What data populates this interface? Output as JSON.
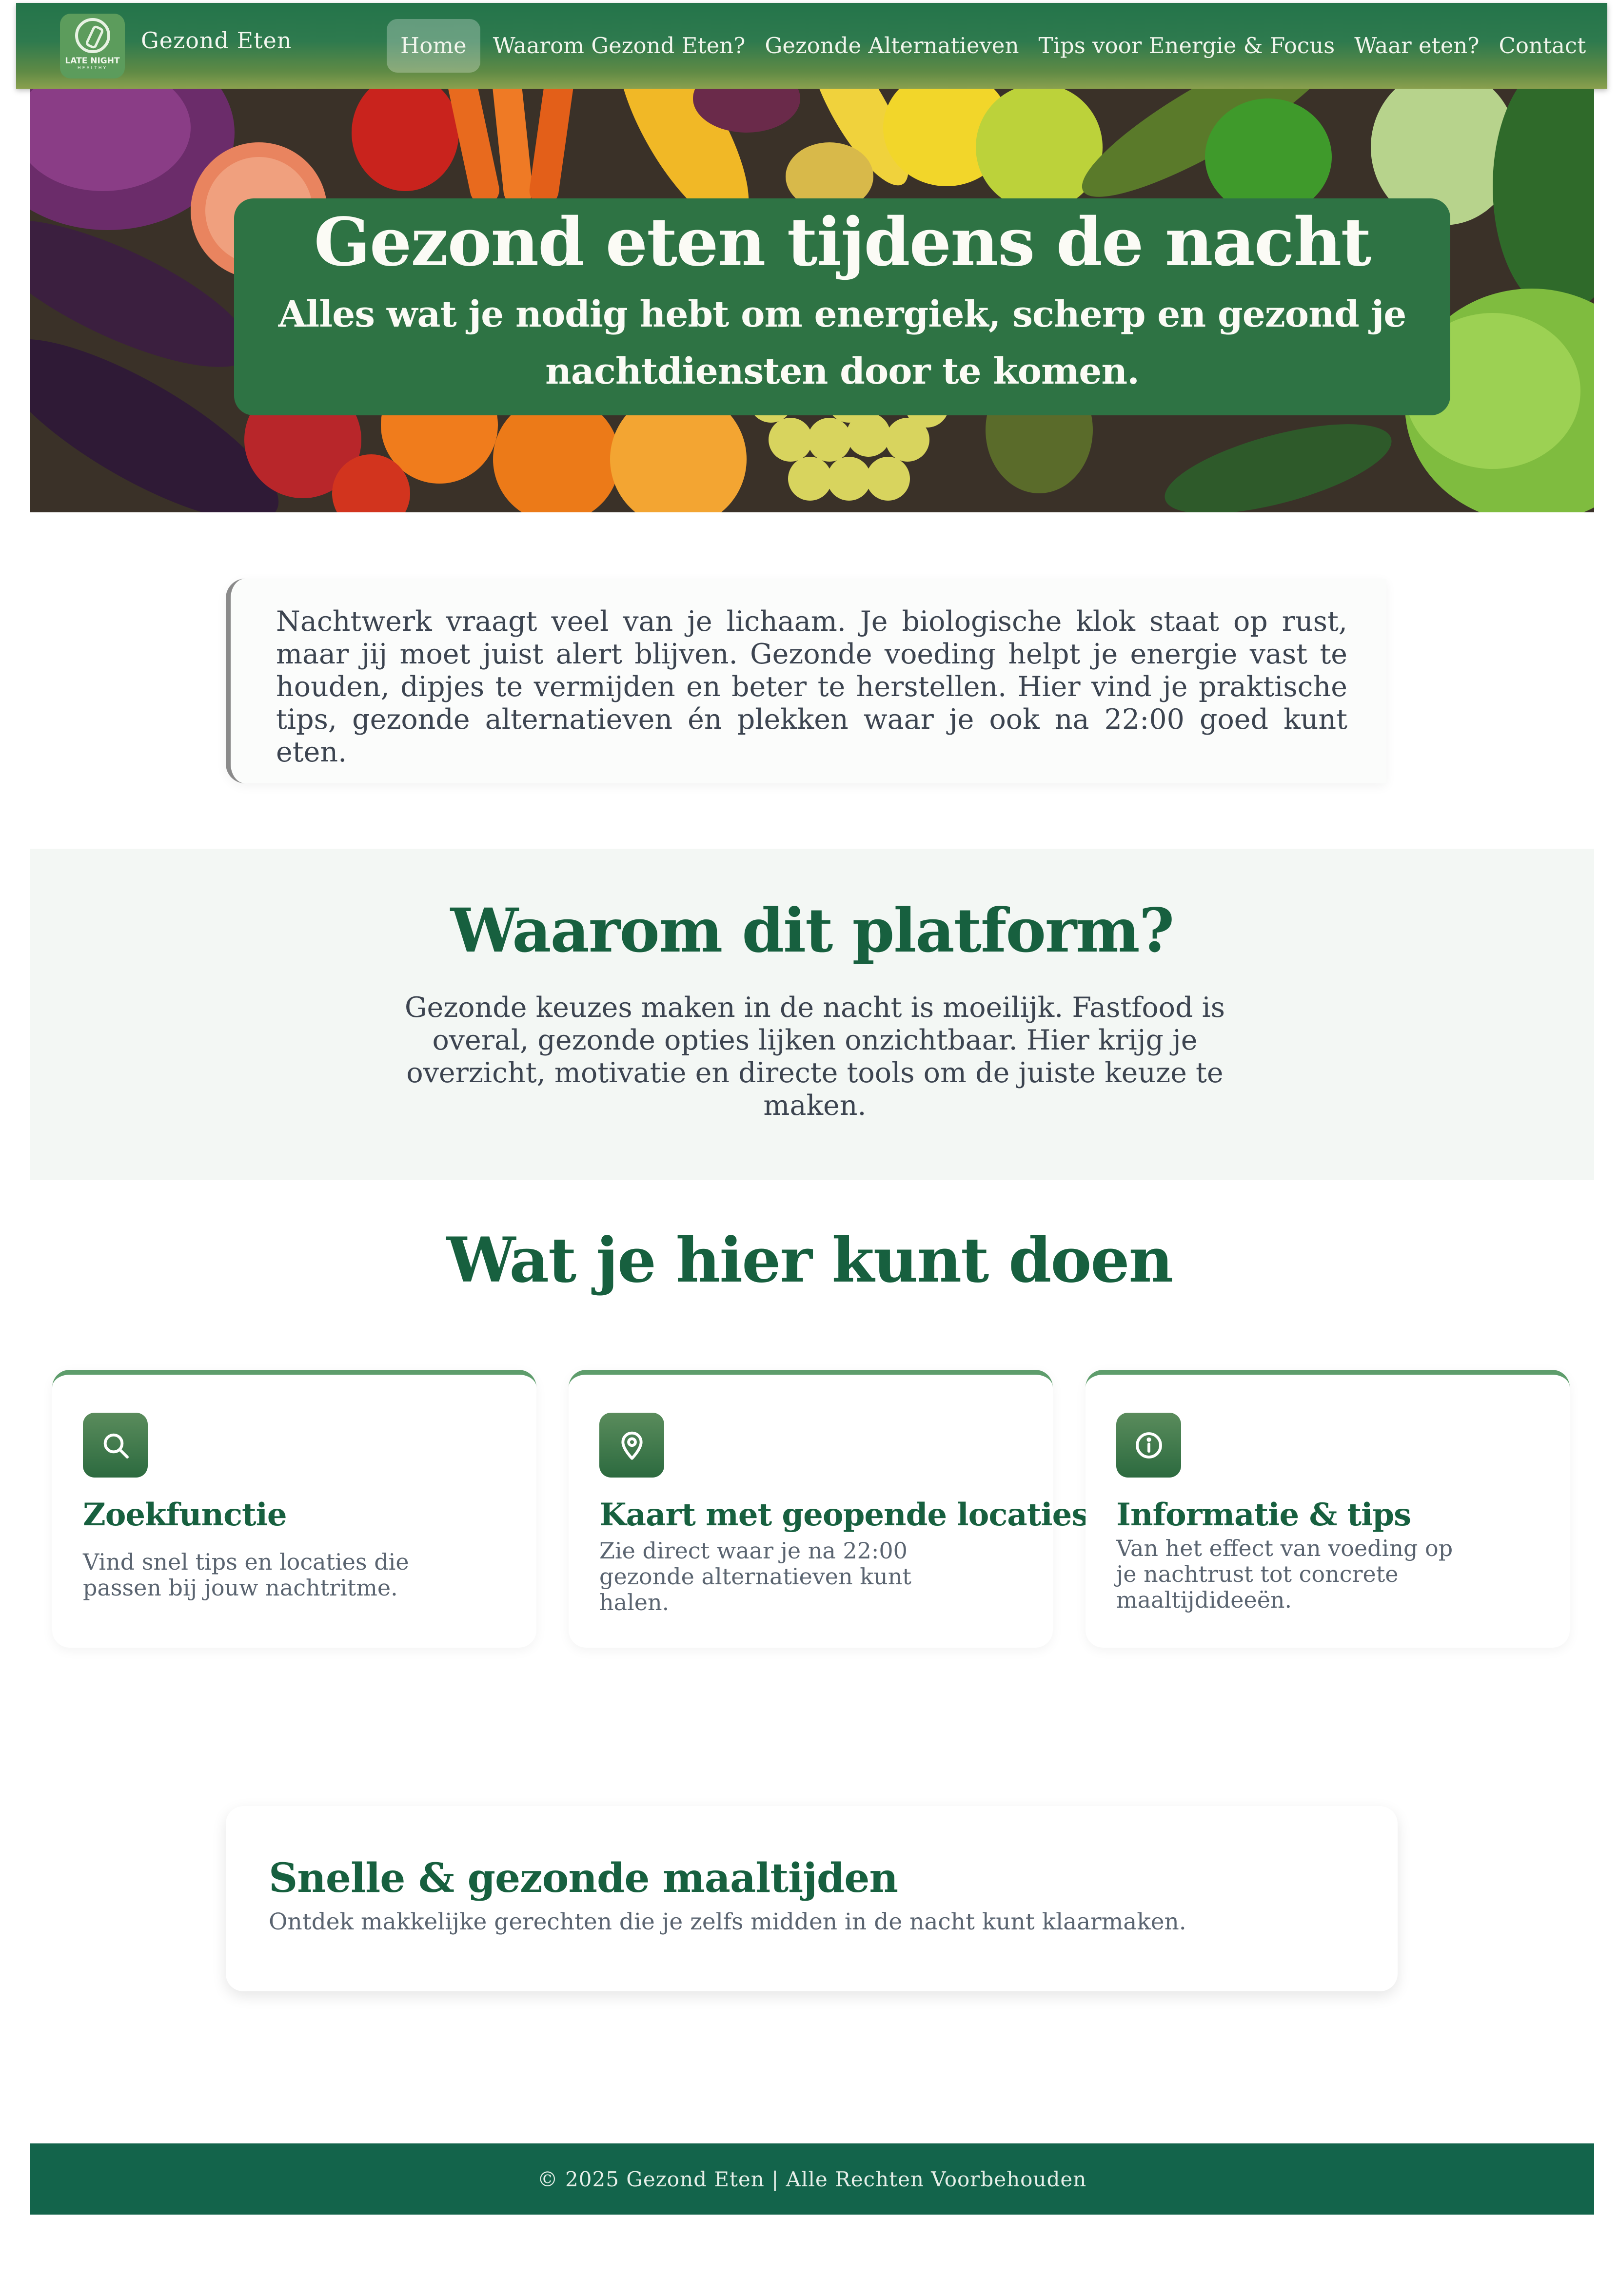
{
  "nav": {
    "logo_text_line1": "LATE NIGHT",
    "logo_text_line2": "HEALTHY",
    "brand": "Gezond Eten",
    "links": [
      {
        "label": "Home",
        "active": true
      },
      {
        "label": "Waarom Gezond Eten?",
        "active": false
      },
      {
        "label": "Gezonde Alternatieven",
        "active": false
      },
      {
        "label": "Tips voor Energie & Focus",
        "active": false
      },
      {
        "label": "Waar eten?",
        "active": false
      },
      {
        "label": "Contact",
        "active": false
      }
    ]
  },
  "hero": {
    "title": "Gezond eten tijdens de nacht",
    "subtitle": "Alles wat je nodig hebt om energiek, scherp en gezond je nachtdiensten door te komen."
  },
  "intro": {
    "text": "Nachtwerk vraagt veel van je lichaam. Je biologische klok staat op rust, maar jij moet juist alert blijven. Gezonde voeding helpt je energie vast te houden, dipjes te vermijden en beter te herstellen. Hier vind je praktische tips, gezonde alternatieven én plekken waar je ook na 22:00 goed kunt eten."
  },
  "why": {
    "title": "Waarom dit platform?",
    "text": "Gezonde keuzes maken in de nacht is moeilijk. Fastfood is overal, gezonde opties lijken onzichtbaar. Hier krijg je overzicht, motivatie en directe tools om de juiste keuze te maken."
  },
  "features": {
    "title": "Wat je hier kunt doen",
    "cards": [
      {
        "icon": "search-icon",
        "title": "Zoekfunctie",
        "text": "Vind snel tips en locaties die passen bij jouw nachtritme."
      },
      {
        "icon": "location-pin-icon",
        "title": "Kaart met geopende locaties",
        "text": "Zie direct waar je na 22:00 gezonde alternatieven kunt halen."
      },
      {
        "icon": "info-icon",
        "title": "Informatie & tips",
        "text": "Van het effect van voeding op je nachtrust tot concrete maaltijdideeën."
      }
    ]
  },
  "meals": {
    "title": "Snelle & gezonde maaltijden",
    "text": "Ontdek makkelijke gerechten die je zelfs midden in de nacht kunt klaarmaken."
  },
  "footer": {
    "text": "© 2025 Gezond Eten | Alle Rechten Voorbehouden"
  },
  "colors": {
    "primary_green": "#17603f",
    "hero_box": "#2e7344",
    "footer": "#13644b",
    "card_border": "#5e9d6c"
  }
}
